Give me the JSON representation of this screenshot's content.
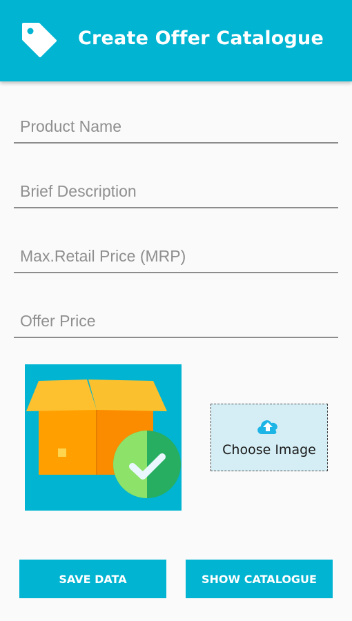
{
  "app_bar": {
    "title": "Create Offer Catalogue",
    "icon": "tag-icon",
    "color": "#00b4d2"
  },
  "form": {
    "product_name": {
      "placeholder": "Product Name",
      "value": ""
    },
    "brief_description": {
      "placeholder": "Brief Description",
      "value": ""
    },
    "mrp": {
      "placeholder": "Max.Retail Price (MRP)",
      "value": ""
    },
    "offer_price": {
      "placeholder": "Offer Price",
      "value": ""
    }
  },
  "image_picker": {
    "preview_icon": "box-check-icon",
    "choose_label": "Choose Image",
    "choose_icon": "cloud-upload-icon",
    "background_color": "#d5eef5"
  },
  "actions": {
    "save_label": "SAVE DATA",
    "show_catalogue_label": "SHOW CATALOGUE"
  },
  "colors": {
    "primary": "#00b4d2",
    "background": "#fafafa",
    "box_front": "#ff9800",
    "box_side": "#fb8c00",
    "box_flaps": "#fdc02f",
    "check_circle": "#2ecc71"
  }
}
